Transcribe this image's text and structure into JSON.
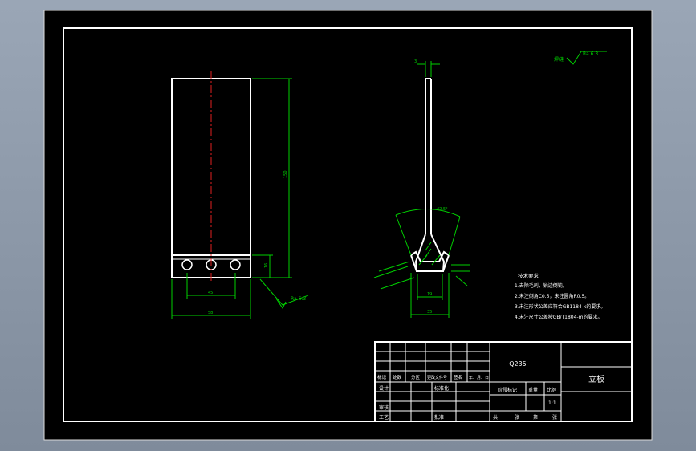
{
  "drawing": {
    "title": "立板",
    "material": "Q235",
    "scale": "1:1",
    "weld_note": "焊缝",
    "roughness_top": "Ra 6.3",
    "roughness_front": "Ra 6.3"
  },
  "dimensions": {
    "front_height": "150",
    "front_bottom": "16",
    "front_width": "58",
    "front_inner": "45",
    "side_top": "3",
    "side_angle": "42.5°",
    "side_w1": "19",
    "side_w2": "35"
  },
  "tech_req": {
    "title": "技术要求",
    "items": [
      "1.去除毛刺，锐边倒钝。",
      "2.未注倒角C0.5，未注圆角R0.5。",
      "3.未注形状公差应符合GB1184-k的要求。",
      "4.未注尺寸公差按GB/T1804-m的要求。"
    ]
  },
  "title_block": {
    "labels": [
      "标记",
      "处数",
      "分区",
      "更改文件号",
      "签名",
      "年、月、日"
    ],
    "design": "设计",
    "standardize": "标准化",
    "review": "审核",
    "process": "工艺",
    "approve": "批准",
    "stage_mark": "阶段标记",
    "weight": "重量",
    "ratio": "比例",
    "sheet_total": "共",
    "sheet_count": "张",
    "sheet_no": "第",
    "sheet_page": "张"
  }
}
